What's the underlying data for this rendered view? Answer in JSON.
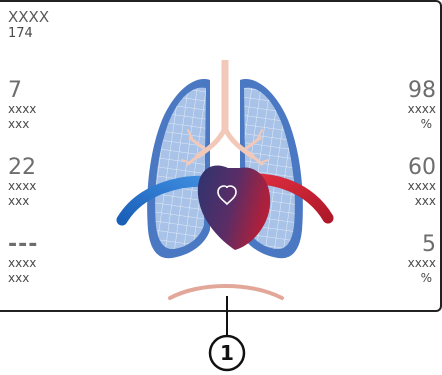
{
  "header": {
    "title": "XXXX",
    "value": "174"
  },
  "left_params": [
    {
      "value": "7",
      "label1": "xxxx",
      "label2": "xxx"
    },
    {
      "value": "22",
      "label1": "xxxx",
      "label2": "xxx"
    },
    {
      "value": "---",
      "label1": "xxxx",
      "label2": "xxx"
    }
  ],
  "right_params": [
    {
      "value": "98",
      "label1": "xxxx",
      "label2": "%"
    },
    {
      "value": "60",
      "label1": "xxxx",
      "label2": "xxx"
    },
    {
      "value": "5",
      "label1": "xxxx",
      "label2": "%"
    }
  ],
  "callout": {
    "number": "1"
  },
  "colors": {
    "lung_fill": "#a9c3e8",
    "lung_outline": "#3f6fb5",
    "heart_dark": "#2d3470",
    "heart_red": "#b0203a",
    "vessel_blue": "#1f6fc7",
    "vessel_red": "#c8202e",
    "airway": "#f2c9b8",
    "diaphragm": "#e3a79a"
  },
  "icons": {
    "graphic": "lungs-heart-icon",
    "heart_symbol": "heart-outline-icon",
    "diaphragm": "diaphragm-arc-icon"
  }
}
